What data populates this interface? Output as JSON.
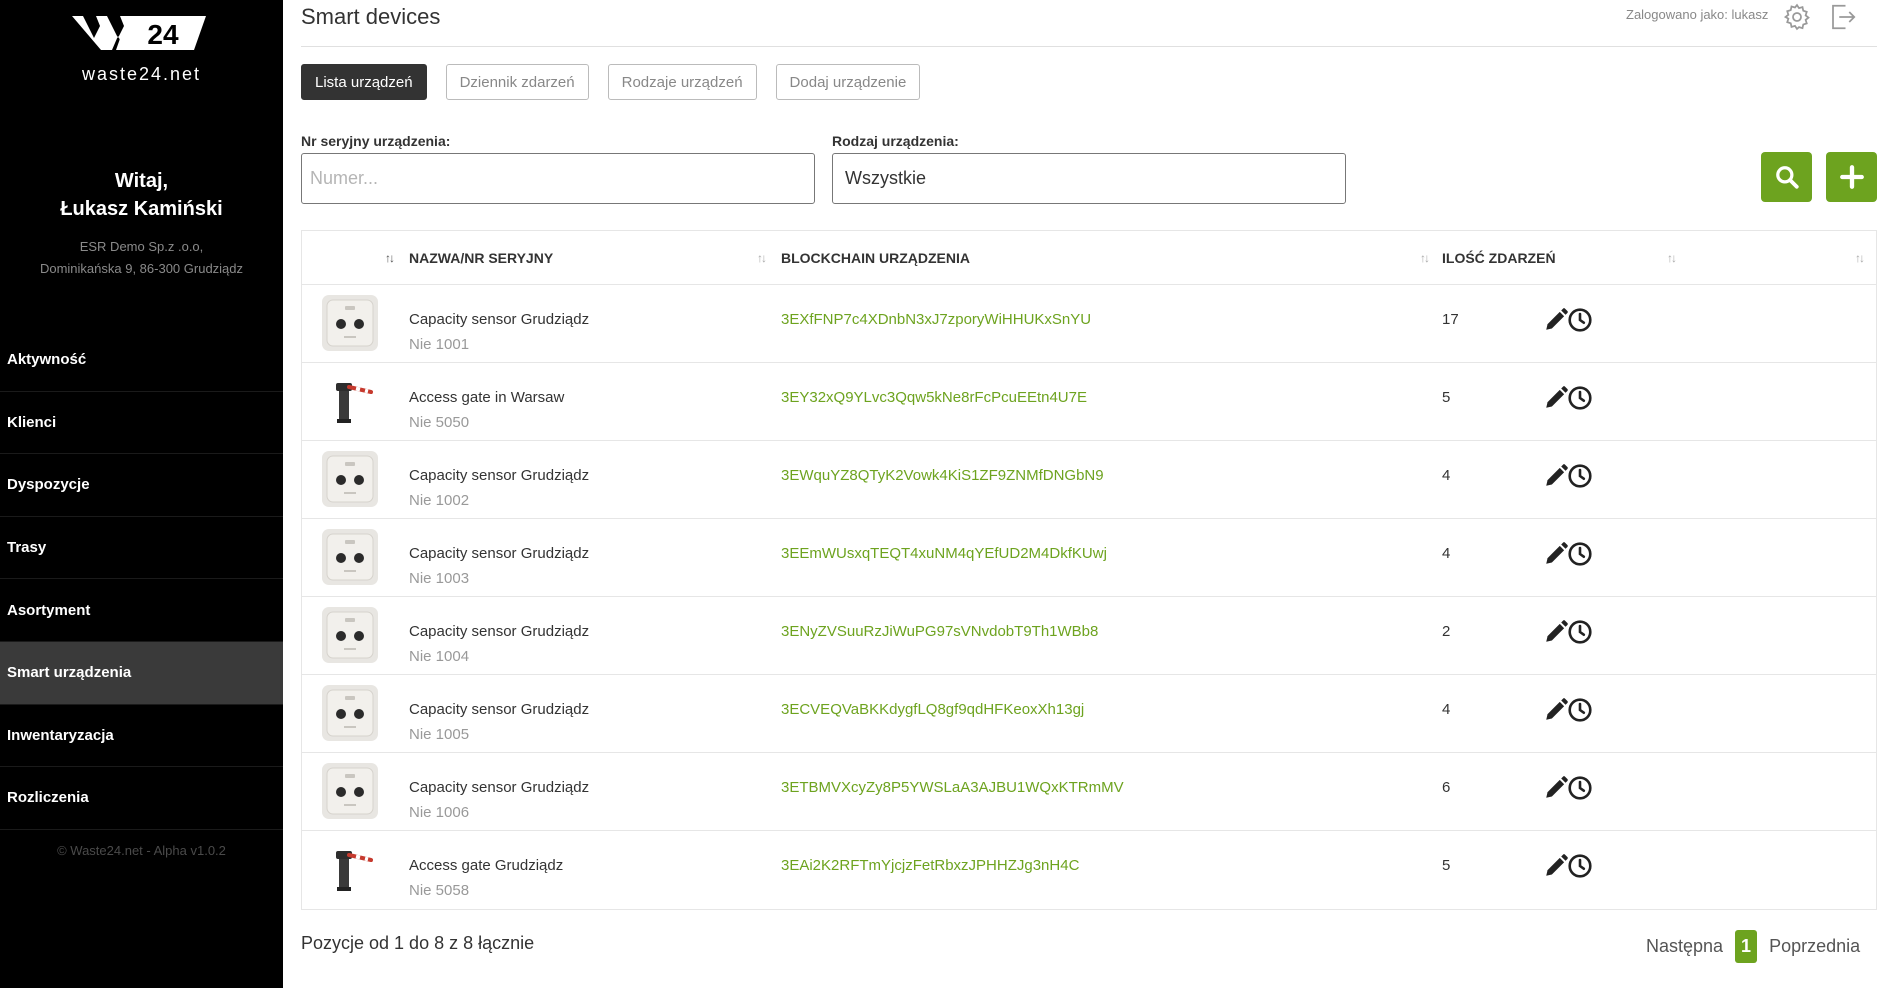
{
  "sidebar": {
    "logo_text": "waste24.net",
    "logo_number": "24",
    "greeting": "Witaj,",
    "user_name": "Łukasz Kamiński",
    "company_name": "ESR Demo Sp.z .o.o,",
    "company_address": "Dominikańska 9, 86-300 Grudziądz",
    "nav": [
      {
        "label": "Aktywność",
        "active": false
      },
      {
        "label": "Klienci",
        "active": false
      },
      {
        "label": "Dyspozycje",
        "active": false
      },
      {
        "label": "Trasy",
        "active": false
      },
      {
        "label": "Asortyment",
        "active": false
      },
      {
        "label": "Smart urządzenia",
        "active": true
      },
      {
        "label": "Inwentaryzacja",
        "active": false
      },
      {
        "label": "Rozliczenia",
        "active": false
      }
    ],
    "footer": "© Waste24.net - Alpha v1.0.2"
  },
  "header": {
    "title": "Smart devices",
    "logged_as": "Zalogowano jako: lukasz",
    "settings_icon": "gear-icon",
    "logout_icon": "logout-icon"
  },
  "tabs": [
    {
      "label": "Lista urządzeń",
      "active": true
    },
    {
      "label": "Dziennik zdarzeń",
      "active": false
    },
    {
      "label": "Rodzaje urządzeń",
      "active": false
    },
    {
      "label": "Dodaj urządzenie",
      "active": false
    }
  ],
  "filters": {
    "serial_label": "Nr seryjny urządzenia:",
    "serial_placeholder": "Numer...",
    "serial_value": "",
    "type_label": "Rodzaj urządzenia:",
    "type_value": "Wszystkie",
    "search_icon": "search-icon",
    "add_icon": "plus-icon"
  },
  "table": {
    "headers": [
      "NAZWA/NR SERYJNY",
      "BLOCKCHAIN URZĄDZENIA",
      "ILOŚĆ ZDARZEŃ"
    ],
    "rows": [
      {
        "type": "sensor",
        "name": "Capacity sensor Grudziądz",
        "serial": "Nie 1001",
        "chain": "3EXfFNP7c4XDnbN3xJ7zporyWiHHUKxSnYU",
        "count": "17"
      },
      {
        "type": "gate",
        "name": "Access gate in Warsaw",
        "serial": "Nie 5050",
        "chain": "3EY32xQ9YLvc3Qqw5kNe8rFcPcuEEtn4U7E",
        "count": "5"
      },
      {
        "type": "sensor",
        "name": "Capacity sensor Grudziądz",
        "serial": "Nie 1002",
        "chain": "3EWquYZ8QTyK2Vowk4KiS1ZF9ZNMfDNGbN9",
        "count": "4"
      },
      {
        "type": "sensor",
        "name": "Capacity sensor Grudziądz",
        "serial": "Nie 1003",
        "chain": "3EEmWUsxqTEQT4xuNM4qYEfUD2M4DkfKUwj",
        "count": "4"
      },
      {
        "type": "sensor",
        "name": "Capacity sensor Grudziądz",
        "serial": "Nie 1004",
        "chain": "3ENyZVSuuRzJiWuPG97sVNvdobT9Th1WBb8",
        "count": "2"
      },
      {
        "type": "sensor",
        "name": "Capacity sensor Grudziądz",
        "serial": "Nie 1005",
        "chain": "3ECVEQVaBKKdygfLQ8gf9qdHFKeoxXh13gj",
        "count": "4"
      },
      {
        "type": "sensor",
        "name": "Capacity sensor Grudziądz",
        "serial": "Nie 1006",
        "chain": "3ETBMVXcyZy8P5YWSLaA3AJBU1WQxKTRmMV",
        "count": "6"
      },
      {
        "type": "gate",
        "name": "Access gate Grudziądz",
        "serial": "Nie 5058",
        "chain": "3EAi2K2RFTmYjcjzFetRbxzJPHHZJg3nH4C",
        "count": "5"
      }
    ]
  },
  "footer": {
    "summary": "Pozycje od 1 do 8 z 8 łącznie",
    "next": "Następna",
    "page": "1",
    "prev": "Poprzednia"
  },
  "colors": {
    "accent": "#6da31f",
    "sidebar": "#000000",
    "sidebar_active": "#3a3a3a"
  }
}
